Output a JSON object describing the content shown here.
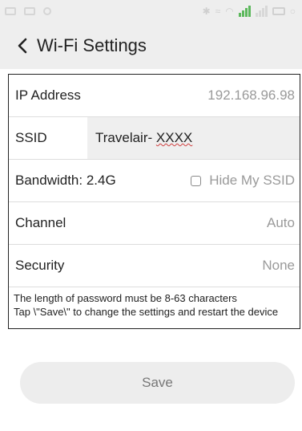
{
  "header": {
    "title": "Wi-Fi Settings",
    "back_icon": "chevron-left-icon"
  },
  "settings": {
    "ip_address": {
      "label": "IP Address",
      "value": "192.168.96.98"
    },
    "ssid": {
      "label": "SSID",
      "value_prefix": "Travelair- ",
      "value_suffix": "XXXX"
    },
    "bandwidth": {
      "label": "Bandwidth: 2.4G",
      "hide_ssid_label": "Hide My SSID",
      "hide_ssid_checked": false
    },
    "channel": {
      "label": "Channel",
      "value": "Auto"
    },
    "security": {
      "label": "Security",
      "value": "None"
    }
  },
  "notes": {
    "line1": "The length of password must be 8-63 characters",
    "line2": "Tap \\\"Save\\\" to change the settings and restart the device"
  },
  "actions": {
    "save_label": "Save"
  },
  "colors": {
    "header_bg": "#eeeeee",
    "signal_green": "#5cb85c",
    "muted_text": "#9a9a9a"
  }
}
